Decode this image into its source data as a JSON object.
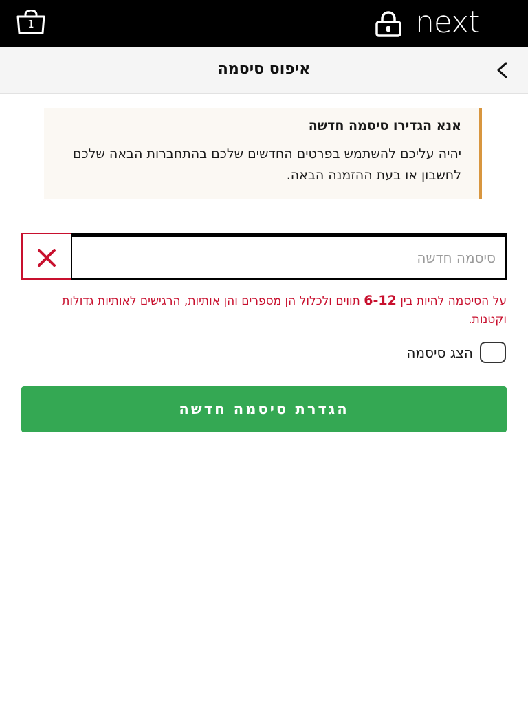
{
  "header": {
    "bag_count": "1",
    "logo_text": "next",
    "icons": {
      "bag": "shopping-bag-icon",
      "lock": "lock-icon",
      "back": "chevron-right-icon",
      "clear": "close-icon"
    },
    "background": "#000000"
  },
  "page": {
    "title": "איפוס סיסמה"
  },
  "notice": {
    "title": "אנא הגדירו סיסמה חדשה",
    "body": "יהיה עליכם להשתמש בפרטים החדשים שלכם בהתחברות הבאה שלכם לחשבון או בעת ההזמנה הבאה.",
    "accent_color": "#d8963f"
  },
  "password_field": {
    "placeholder": "סיסמה חדשה",
    "value": "",
    "error_color": "#c8102e"
  },
  "error": {
    "prefix": "על הסיסמה להיות בין ",
    "range": "6-12",
    "suffix": " תווים ולכלול הן מספרים והן אותיות, הרגישים לאותיות גדולות וקטנות."
  },
  "show_password": {
    "label": "הצג סיסמה",
    "checked": false
  },
  "submit": {
    "label": "הגדרת סיסמה חדשה",
    "color": "#34a853"
  }
}
